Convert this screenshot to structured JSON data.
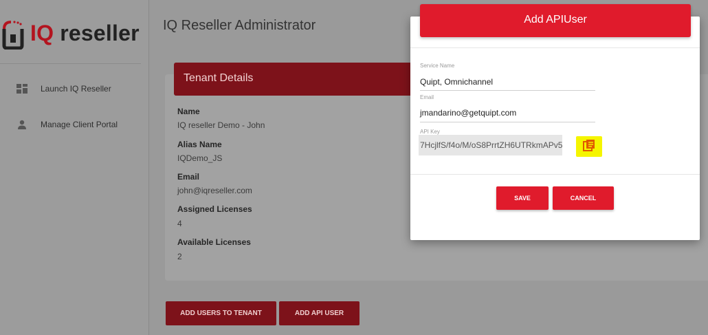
{
  "brand": {
    "logo_iq": "IQ",
    "logo_rest": "reseller"
  },
  "sidebar": {
    "items": [
      {
        "label": "Launch IQ Reseller",
        "icon": "dashboard-icon"
      },
      {
        "label": "Manage Client Portal",
        "icon": "user-icon"
      }
    ]
  },
  "page": {
    "title": "IQ Reseller Administrator"
  },
  "tenant": {
    "header": "Tenant Details",
    "fields": [
      {
        "label": "Name",
        "value": "IQ reseller Demo - John"
      },
      {
        "label": "Alias Name",
        "value": "IQDemo_JS"
      },
      {
        "label": "Email",
        "value": "john@iqreseller.com"
      },
      {
        "label": "Assigned Licenses",
        "value": "4"
      },
      {
        "label": "Available Licenses",
        "value": "2"
      }
    ]
  },
  "actions": {
    "add_users": "ADD USERS TO TENANT",
    "add_api_user": "ADD API USER"
  },
  "modal": {
    "title": "Add APIUser",
    "service_name_label": "Service Name",
    "service_name_value": "Quipt, Omnichannel",
    "email_label": "Email",
    "email_value": "jmandarino@getquipt.com",
    "api_key_label": "API Key",
    "api_key_value": "7HcjlfS/f4o/M/oS8PrrtZH6UTRkmAPv5",
    "copy_icon": "copy-icon",
    "save_label": "SAVE",
    "cancel_label": "CANCEL"
  },
  "colors": {
    "brand_red": "#e01b2c",
    "dim_red": "#7d121a",
    "highlight": "#f5f500"
  }
}
